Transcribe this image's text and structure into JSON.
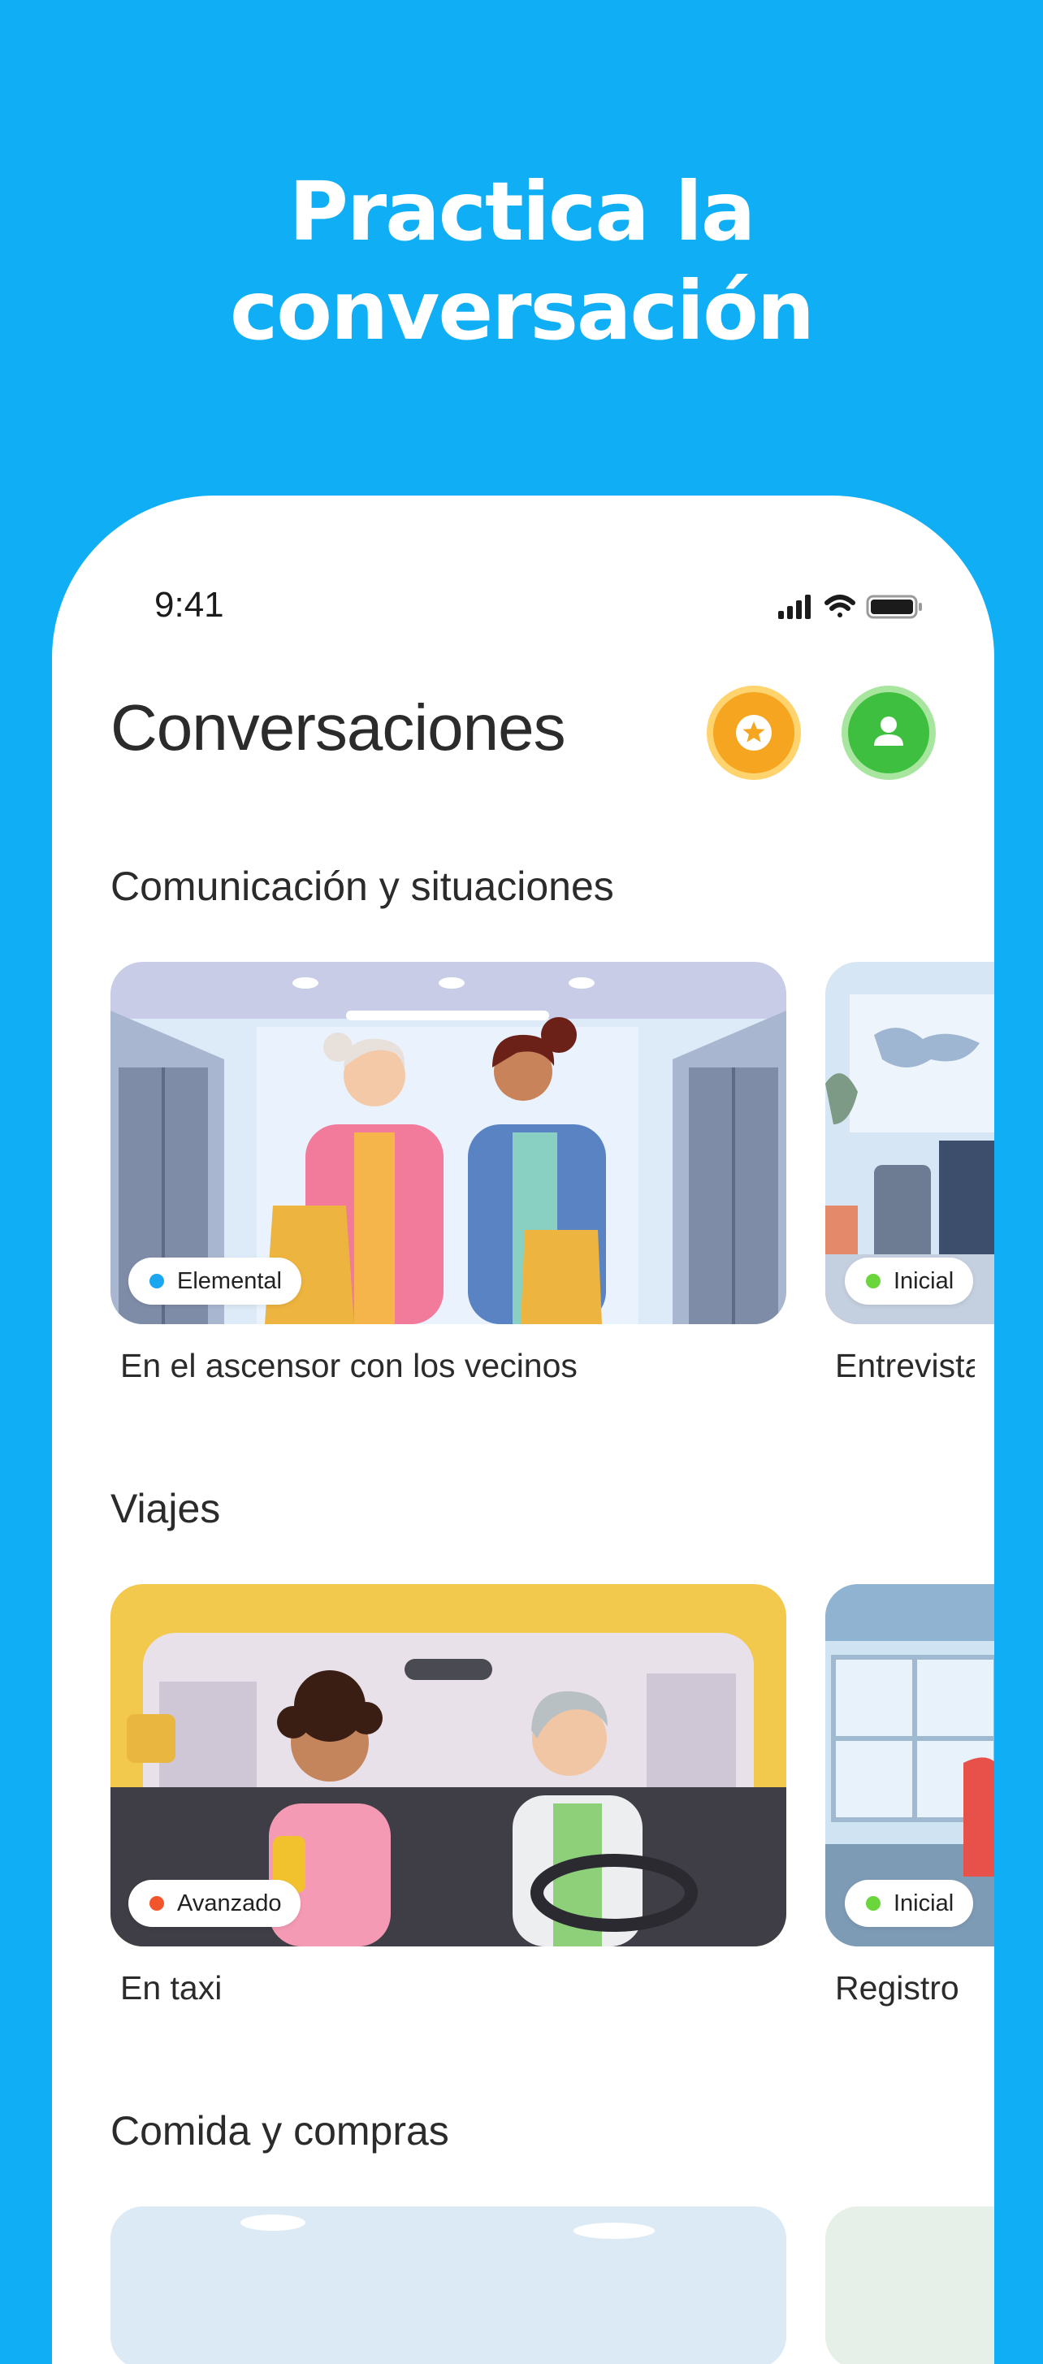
{
  "promo": {
    "headline_line1": "Practica la",
    "headline_line2": "conversación"
  },
  "status_bar": {
    "time": "9:41",
    "icons": [
      "signal-icon",
      "wifi-icon",
      "battery-icon"
    ]
  },
  "header": {
    "title": "Conversaciones",
    "star_button_icon": "star-icon",
    "profile_button_icon": "user-icon"
  },
  "sections": [
    {
      "title": "Comunicación y situaciones",
      "cards": [
        {
          "label": "En el ascensor con los vecinos",
          "level": "Elemental",
          "level_color": "#1AA7F0"
        },
        {
          "label": "Entrevista",
          "level": "Inicial",
          "level_color": "#6BD63B"
        }
      ]
    },
    {
      "title": "Viajes",
      "cards": [
        {
          "label": "En taxi",
          "level": "Avanzado",
          "level_color": "#F2552C"
        },
        {
          "label": "Registro",
          "level": "Inicial",
          "level_color": "#6BD63B"
        }
      ]
    },
    {
      "title": "Comida y compras",
      "cards": []
    }
  ],
  "colors": {
    "background": "#10AEF5",
    "star_button": "#F6A521",
    "profile_button": "#3FBF3F"
  }
}
